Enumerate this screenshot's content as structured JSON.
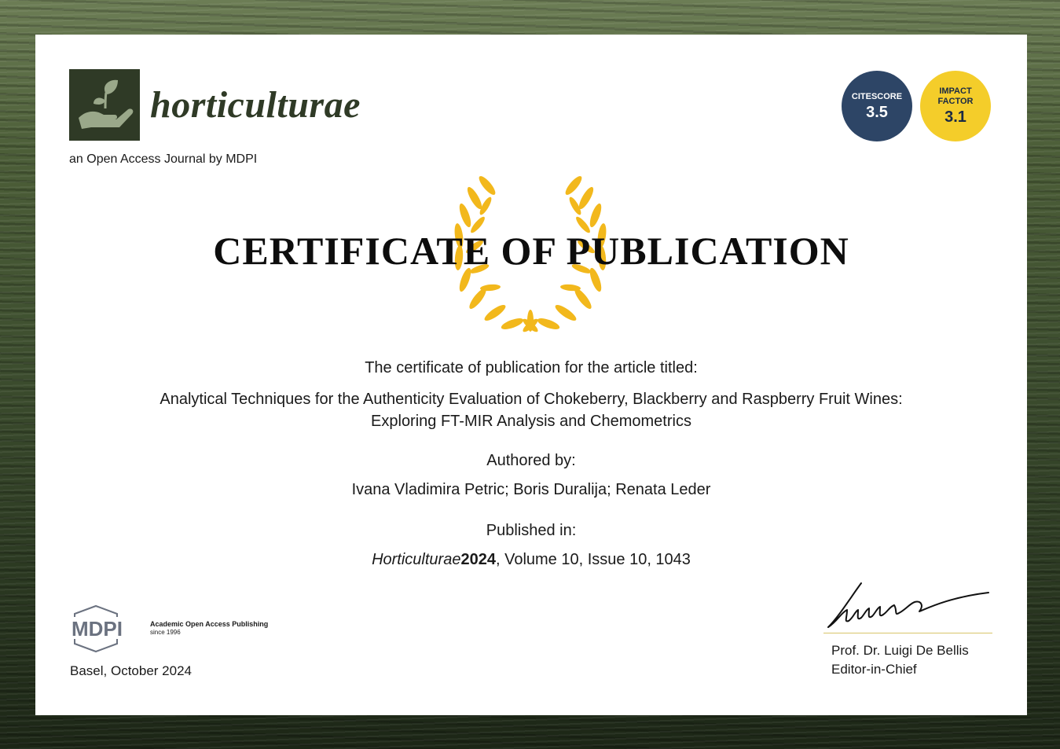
{
  "journal": {
    "name": "horticulturae",
    "subtitle": "an Open Access Journal by MDPI"
  },
  "badges": {
    "citescore_label": "CITESCORE",
    "citescore_value": "3.5",
    "impact_label_1": "IMPACT",
    "impact_label_2": "FACTOR",
    "impact_value": "3.1"
  },
  "certificate": {
    "title": "CERTIFICATE OF PUBLICATION",
    "intro": "The certificate of publication for the article titled:",
    "article_title_line1": "Analytical Techniques for the Authenticity Evaluation of Chokeberry, Blackberry and Raspberry Fruit Wines:",
    "article_title_line2": "Exploring FT-MIR Analysis and Chemometrics",
    "authored_label": "Authored by:",
    "authors": "Ivana Vladimira Petric; Boris Duralija; Renata Leder",
    "published_label": "Published in:",
    "pub_journal": "Horticulturae",
    "pub_year": "2024",
    "pub_details": ", Volume 10, Issue 10, 1043"
  },
  "publisher": {
    "logo_text": "MDPI",
    "tagline": "Academic Open Access Publishing",
    "since": "since 1996",
    "place_date": "Basel, October 2024"
  },
  "editor": {
    "name": "Prof. Dr. Luigi De Bellis",
    "role": "Editor-in-Chief"
  },
  "colors": {
    "journal_green": "#2f3a26",
    "citescore_blue": "#2d4566",
    "impact_yellow": "#f4cd2a",
    "laurel_gold": "#f2b81c"
  }
}
